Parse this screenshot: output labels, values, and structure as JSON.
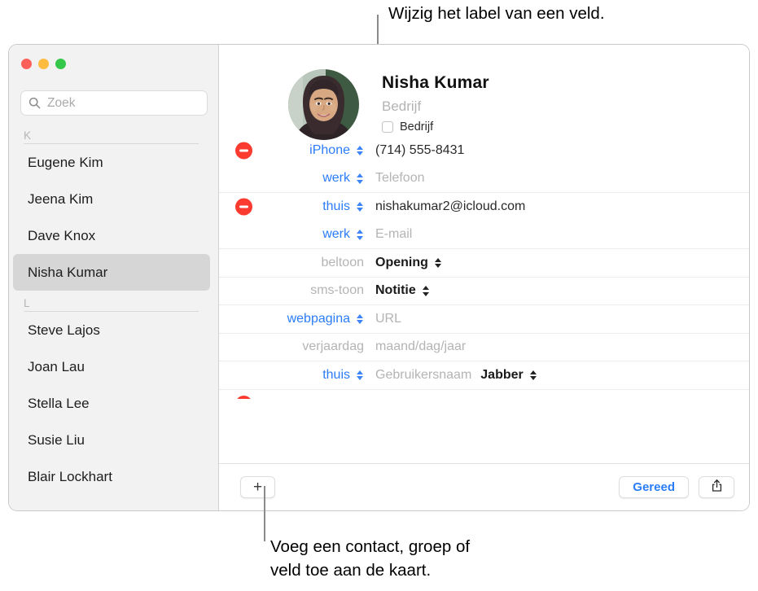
{
  "callouts": {
    "top": "Wijzig het label van een veld.",
    "bottom": "Voeg een contact, groep of\nveld toe aan de kaart."
  },
  "window": {
    "traffic_lights": [
      {
        "name": "close",
        "color": "#fc6058"
      },
      {
        "name": "minimize",
        "color": "#fdbc40"
      },
      {
        "name": "zoom",
        "color": "#34c749"
      }
    ]
  },
  "sidebar": {
    "search": {
      "icon": "search-icon",
      "placeholder": "Zoek",
      "value": ""
    },
    "sections": [
      {
        "letter": "K",
        "contacts": [
          {
            "name": "Eugene Kim",
            "selected": false
          },
          {
            "name": "Jeena Kim",
            "selected": false
          },
          {
            "name": "Dave Knox",
            "selected": false
          },
          {
            "name": "Nisha Kumar",
            "selected": true
          }
        ]
      },
      {
        "letter": "L",
        "contacts": [
          {
            "name": "Steve Lajos",
            "selected": false
          },
          {
            "name": "Joan Lau",
            "selected": false
          },
          {
            "name": "Stella Lee",
            "selected": false
          },
          {
            "name": "Susie Liu",
            "selected": false
          },
          {
            "name": "Blair Lockhart",
            "selected": false
          }
        ]
      }
    ]
  },
  "detail": {
    "avatar": "contact-photo",
    "name": "Nisha  Kumar",
    "company_placeholder": "Bedrijf",
    "company_checkbox_label": "Bedrijf",
    "company_checkbox_checked": false,
    "fields": [
      {
        "has_delete": true,
        "label": "iPhone",
        "label_style": "blue",
        "has_stepper": true,
        "value": "(714) 555-8431",
        "value_style": "filled",
        "rule": false
      },
      {
        "has_delete": false,
        "label": "werk",
        "label_style": "blue",
        "has_stepper": true,
        "value": "Telefoon",
        "value_style": "placeholder",
        "rule": false
      },
      {
        "has_delete": true,
        "label": "thuis",
        "label_style": "blue",
        "has_stepper": true,
        "value": "nishakumar2@icloud.com",
        "value_style": "filled",
        "rule": true
      },
      {
        "has_delete": false,
        "label": "werk",
        "label_style": "blue",
        "has_stepper": true,
        "value": "E-mail",
        "value_style": "placeholder",
        "rule": false
      },
      {
        "has_delete": false,
        "label": "beltoon",
        "label_style": "gray",
        "has_stepper": false,
        "value": "Opening",
        "value_style": "strong-select",
        "rule": true
      },
      {
        "has_delete": false,
        "label": "sms-toon",
        "label_style": "gray",
        "has_stepper": false,
        "value": "Notitie",
        "value_style": "strong-select",
        "rule": true
      },
      {
        "has_delete": false,
        "label": "webpagina",
        "label_style": "blue",
        "has_stepper": true,
        "value": "URL",
        "value_style": "placeholder",
        "rule": true
      },
      {
        "has_delete": false,
        "label": "verjaardag",
        "label_style": "gray",
        "has_stepper": false,
        "value": "maand/dag/jaar",
        "value_style": "placeholder",
        "rule": true
      },
      {
        "has_delete": false,
        "label": "thuis",
        "label_style": "blue",
        "has_stepper": true,
        "value": "Gebruikersnaam",
        "value_style": "placeholder",
        "sub_value": "Jabber",
        "rule": true
      }
    ]
  },
  "toolbar": {
    "add_label": "+",
    "add_icon": "plus-icon",
    "done_label": "Gereed",
    "share_icon": "share-icon"
  }
}
